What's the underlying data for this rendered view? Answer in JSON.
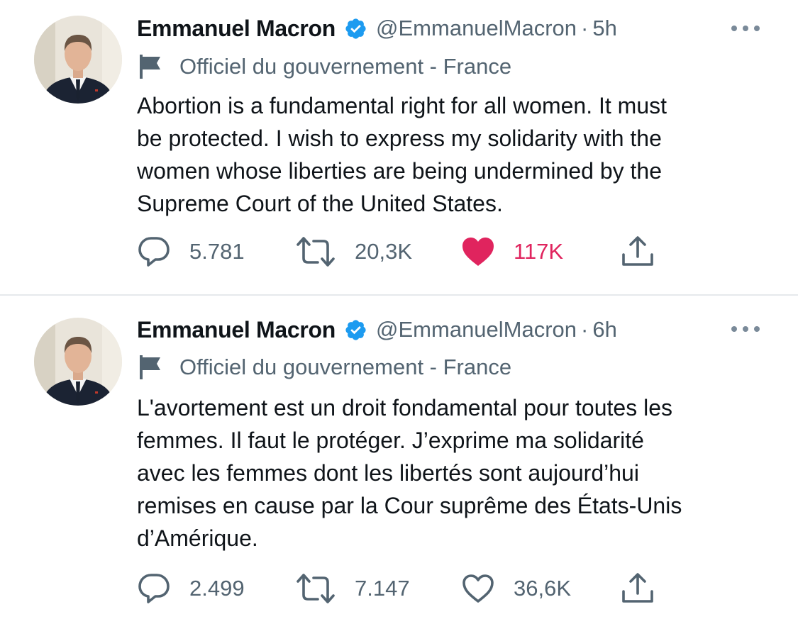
{
  "colors": {
    "verified_badge": "#1d9bf0",
    "like_active": "#e0245e",
    "secondary_text": "#536471",
    "primary_text": "#0f1419",
    "divider": "#e6e9ec"
  },
  "tweets": [
    {
      "author": {
        "name": "Emmanuel Macron",
        "handle": "@EmmanuelMacron",
        "verified": true,
        "avatar_icon": "profile-photo"
      },
      "separator": "·",
      "time": "5h",
      "label": {
        "icon": "flag-icon",
        "text": "Officiel du gouvernement - France"
      },
      "text_lines": [
        "Abortion is a fundamental right for all women. It must",
        "be protected. I wish to express my solidarity with the",
        "women whose liberties are being undermined by the",
        "Supreme Court of the United States."
      ],
      "stats": {
        "replies": "5.781",
        "retweets": "20,3K",
        "likes": "117K",
        "liked": true
      }
    },
    {
      "author": {
        "name": "Emmanuel Macron",
        "handle": "@EmmanuelMacron",
        "verified": true,
        "avatar_icon": "profile-photo"
      },
      "separator": "·",
      "time": "6h",
      "label": {
        "icon": "flag-icon",
        "text": "Officiel du gouvernement - France"
      },
      "text_lines": [
        "L'avortement est un droit fondamental pour toutes les",
        "femmes. Il faut le protéger. J’exprime ma solidarité",
        "avec les femmes dont les libertés sont aujourd’hui",
        "remises en cause par la Cour suprême des États-Unis",
        "d’Amérique."
      ],
      "stats": {
        "replies": "2.499",
        "retweets": "7.147",
        "likes": "36,6K",
        "liked": false
      }
    }
  ]
}
